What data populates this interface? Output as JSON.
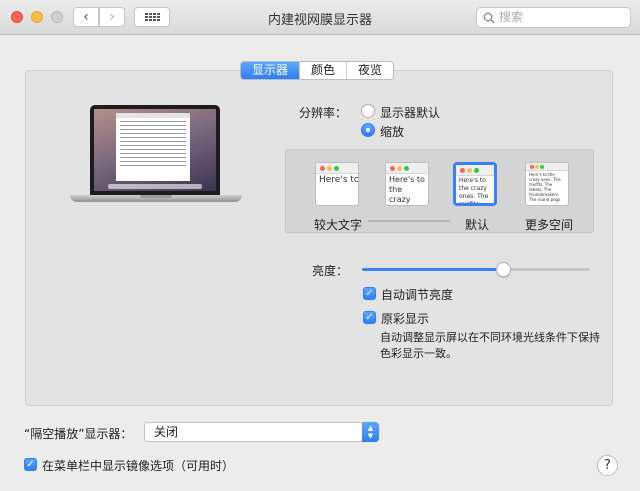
{
  "window": {
    "title": "内建视网膜显示器"
  },
  "toolbar": {
    "back_glyph": "‹",
    "forward_glyph": "›"
  },
  "search": {
    "placeholder": "搜索"
  },
  "tabs": [
    {
      "label": "显示器",
      "active": true
    },
    {
      "label": "颜色",
      "active": false
    },
    {
      "label": "夜览",
      "active": false
    }
  ],
  "resolution": {
    "label": "分辨率：",
    "options": [
      {
        "label": "显示器默认",
        "selected": false
      },
      {
        "label": "缩放",
        "selected": true
      }
    ]
  },
  "scaling": {
    "sample_text": "Here's to the crazy ones. The misfits. The rebels. The troublemakers. The round pegs",
    "options": [
      {
        "label": "较大文字",
        "selected": false
      },
      {
        "label": "",
        "selected": false
      },
      {
        "label": "默认",
        "selected": true
      },
      {
        "label": "更多空间",
        "selected": false
      }
    ]
  },
  "brightness": {
    "label": "亮度：",
    "level": 0.62
  },
  "auto_brightness": {
    "label": "自动调节亮度",
    "checked": true
  },
  "true_tone": {
    "label": "原彩显示",
    "checked": true,
    "description": "自动调整显示屏以在不同环境光线条件下保持色彩显示一致。"
  },
  "airplay": {
    "label": "“隔空播放”显示器：",
    "value": "关闭"
  },
  "mirroring": {
    "label": "在菜单栏中显示镜像选项（可用时）",
    "checked": true
  },
  "help": {
    "glyph": "?"
  },
  "colors": {
    "accent": "#3b82f6"
  }
}
